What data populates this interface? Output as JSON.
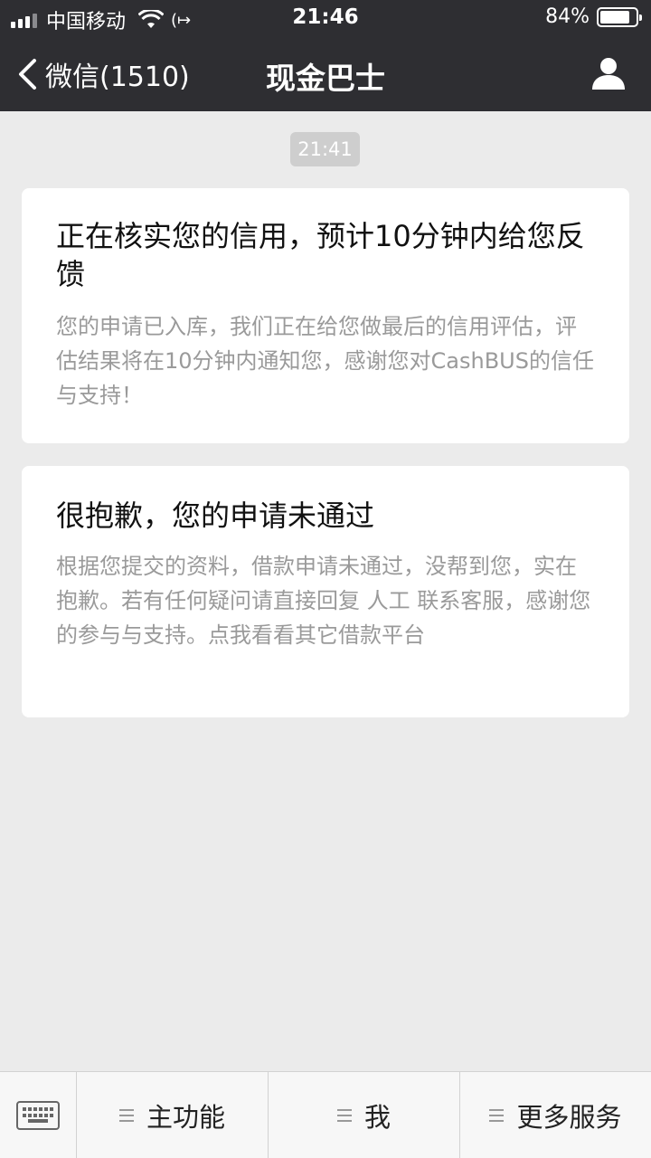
{
  "status_bar": {
    "carrier": "中国移动",
    "time": "21:46",
    "battery_percent": "84%",
    "battery_level": 0.84
  },
  "nav": {
    "back_label": "微信(1510)",
    "title": "现金巴士"
  },
  "chat": {
    "timestamp": "21:41",
    "messages": [
      {
        "title": "正在核实您的信用，预计10分钟内给您反馈",
        "body": "您的申请已入库，我们正在给您做最后的信用评估，评估结果将在10分钟内通知您，感谢您对CashBUS的信任与支持！"
      },
      {
        "title": "很抱歉，您的申请未通过",
        "body": "根据您提交的资料，借款申请未通过，没帮到您，实在抱歉。若有任何疑问请直接回复 人工 联系客服，感谢您的参与与支持。点我看看其它借款平台"
      }
    ]
  },
  "bottom_menu": {
    "items": [
      {
        "label": "主功能"
      },
      {
        "label": "我"
      },
      {
        "label": "更多服务"
      }
    ]
  }
}
